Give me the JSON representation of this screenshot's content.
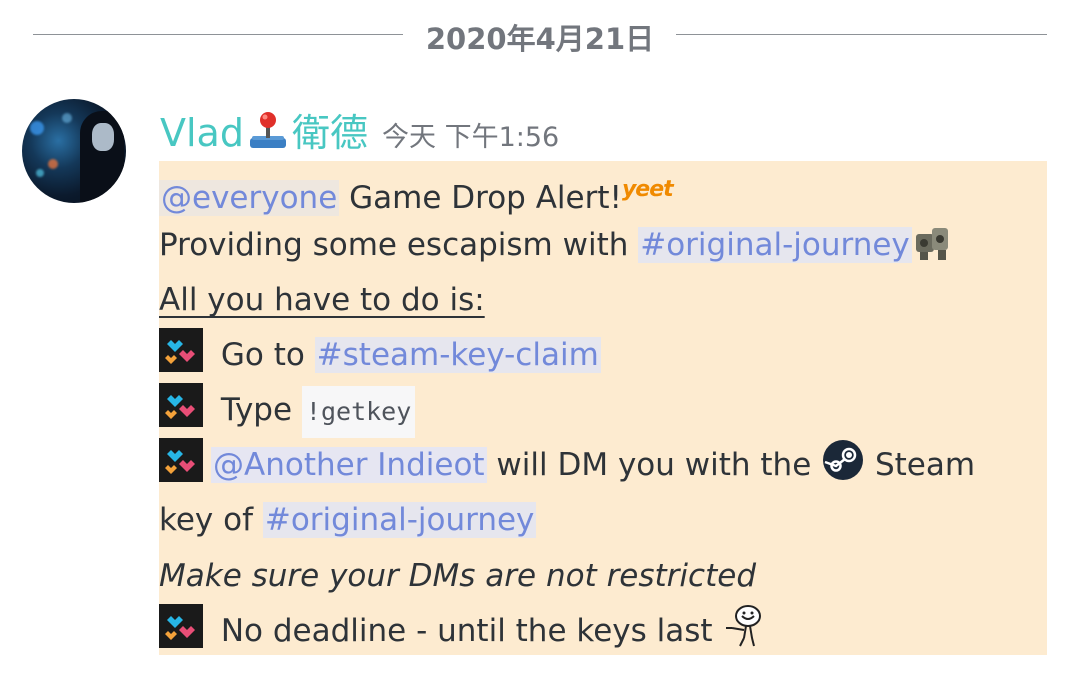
{
  "divider": {
    "date": "2020年4月21日"
  },
  "author": {
    "name": "Vlad",
    "name_suffix": "衛德",
    "timestamp": "今天 下午1:56"
  },
  "message": {
    "line1": {
      "mention": "@everyone",
      "text": " Game Drop Alert!",
      "emoji_label": "yeet"
    },
    "line2": {
      "text": "Providing some escapism with ",
      "channel": "#original-journey"
    },
    "line3": {
      "text": "All you have to do is:"
    },
    "line4": {
      "text": " Go to ",
      "channel": "#steam-key-claim"
    },
    "line5": {
      "text": " Type ",
      "code": "!getkey"
    },
    "line6": {
      "mention": "@Another Indieot",
      "text": " will DM you with the ",
      "text2": " Steam"
    },
    "line7": {
      "text": "key of ",
      "channel": "#original-journey"
    },
    "line8": {
      "text": "Make sure your DMs are not restricted"
    },
    "line9": {
      "text": " No deadline - until the keys last "
    }
  },
  "colors": {
    "username": "#48c7c2",
    "mention": "#7289da",
    "highlight_bg": "#fdebd0",
    "timestamp": "#72767d"
  },
  "icons": [
    "joystick-icon",
    "yeet-emoji",
    "robot-emoji",
    "hearts-emoji",
    "steam-icon",
    "meme-guy-emoji"
  ]
}
